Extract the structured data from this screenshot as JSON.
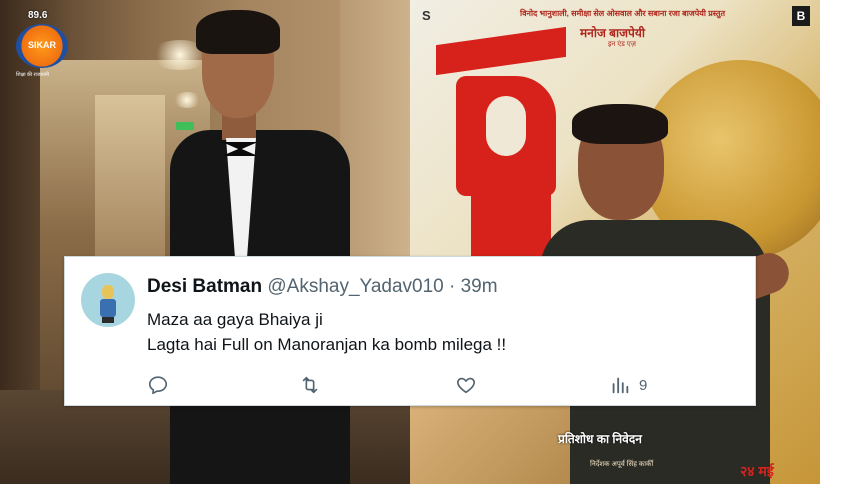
{
  "logo": {
    "frequency": "89.6",
    "station": "SIKAR",
    "tagline": "शिक्षा की राजधानी"
  },
  "poster": {
    "top_credit": "विनोद भानुशाली, समीक्षा सेल ओसवाल और सबाना रजा बाजपेयी प्रस्तुत",
    "actor": "मनोज बाजपेयी",
    "actor_sub": "इन एंड एज़",
    "brand_letter": "B",
    "tagline": "प्रतिशोध का निवेदन",
    "director": "निर्देशक अपूर्व सिंह कार्की",
    "date": "२४ मई"
  },
  "tweet": {
    "display_name": "Desi Batman",
    "handle": "@Akshay_Yadav010",
    "separator": "·",
    "time": "39m",
    "lines": [
      "Maza aa gaya Bhaiya ji",
      "Lagta hai Full on Manoranjan ka bomb milega !!"
    ],
    "actions": {
      "reply": {
        "icon": "reply-icon",
        "count": ""
      },
      "retweet": {
        "icon": "retweet-icon",
        "count": ""
      },
      "like": {
        "icon": "heart-icon",
        "count": ""
      },
      "views": {
        "icon": "views-icon",
        "count": "9"
      }
    },
    "colors": {
      "text": "#0f1419",
      "secondary": "#536471",
      "border": "#cfd9de"
    }
  }
}
